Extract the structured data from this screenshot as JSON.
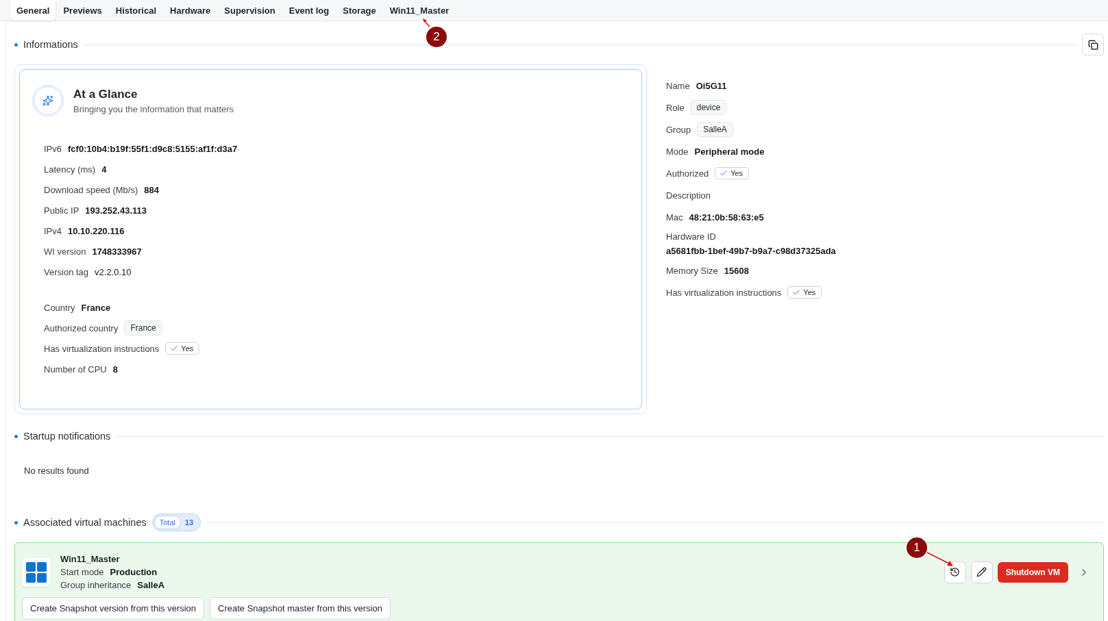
{
  "tabs": [
    {
      "label": "General",
      "selected": true
    },
    {
      "label": "Previews",
      "selected": false
    },
    {
      "label": "Historical",
      "selected": false
    },
    {
      "label": "Hardware",
      "selected": false
    },
    {
      "label": "Supervision",
      "selected": false
    },
    {
      "label": "Event log",
      "selected": false
    },
    {
      "label": "Storage",
      "selected": false
    },
    {
      "label": "Win11_Master",
      "selected": false
    }
  ],
  "informations": {
    "title": "Informations",
    "glance": {
      "title": "At a Glance",
      "subtitle": "Bringing you the information that matters",
      "groups": [
        [
          {
            "label": "IPv6",
            "value": "fcf0:10b4:b19f:55f1:d9c8:5155:af1f:d3a7",
            "kind": "bold"
          },
          {
            "label": "Latency (ms)",
            "value": "4",
            "kind": "bold"
          },
          {
            "label": "Download speed (Mb/s)",
            "value": "884",
            "kind": "bold"
          },
          {
            "label": "Public IP",
            "value": "193.252.43.113",
            "kind": "bold"
          },
          {
            "label": "IPv4",
            "value": "10.10.220.116",
            "kind": "bold"
          },
          {
            "label": "WI version",
            "value": "1748333967",
            "kind": "bold"
          },
          {
            "label": "Version tag",
            "value": "v2.2.0.10",
            "kind": "plain"
          }
        ],
        [
          {
            "label": "Country",
            "value": "France",
            "kind": "bold"
          },
          {
            "label": "Authorized country",
            "value": "France",
            "kind": "tag"
          },
          {
            "label": "Has virtualization instructions",
            "value": "Yes",
            "kind": "check"
          },
          {
            "label": "Number of CPU",
            "value": "8",
            "kind": "bold"
          }
        ]
      ]
    },
    "details": [
      {
        "label": "Name",
        "value": "Oi5G11",
        "kind": "bold"
      },
      {
        "label": "Role",
        "value": "device",
        "kind": "tag"
      },
      {
        "label": "Group",
        "value": "SalleA",
        "kind": "tag"
      },
      {
        "label": "Mode",
        "value": "Peripheral mode",
        "kind": "bold"
      },
      {
        "label": "Authorized",
        "value": "Yes",
        "kind": "check"
      },
      {
        "label": "Description",
        "kind": "empty"
      },
      {
        "label": "Mac",
        "value": "48:21:0b:58:63:e5",
        "kind": "bold"
      },
      {
        "label": "Hardware ID",
        "value": "a5681fbb-1bef-49b7-b9a7-c98d37325ada",
        "kind": "stacked"
      },
      {
        "label": "Memory Size",
        "value": "15608",
        "kind": "bold"
      },
      {
        "label": "Has virtualization instructions",
        "value": "Yes",
        "kind": "check"
      }
    ]
  },
  "startup_notifications": {
    "title": "Startup notifications",
    "empty_text": "No results found"
  },
  "associated_vms": {
    "title": "Associated virtual machines",
    "total_label": "Total",
    "total": "13",
    "vms": [
      {
        "name": "Win11_Master",
        "fields": [
          {
            "label": "Start mode",
            "value": "Production"
          },
          {
            "label": "Group inheritance",
            "value": "SalleA"
          }
        ],
        "shutdown_label": "Shutdown VM",
        "snapshot_buttons": [
          "Create Snapshot version from this version",
          "Create Snapshot master from this version"
        ]
      }
    ]
  },
  "annotations": [
    {
      "number": "2",
      "kind": "up"
    },
    {
      "number": "1",
      "kind": "down"
    }
  ]
}
